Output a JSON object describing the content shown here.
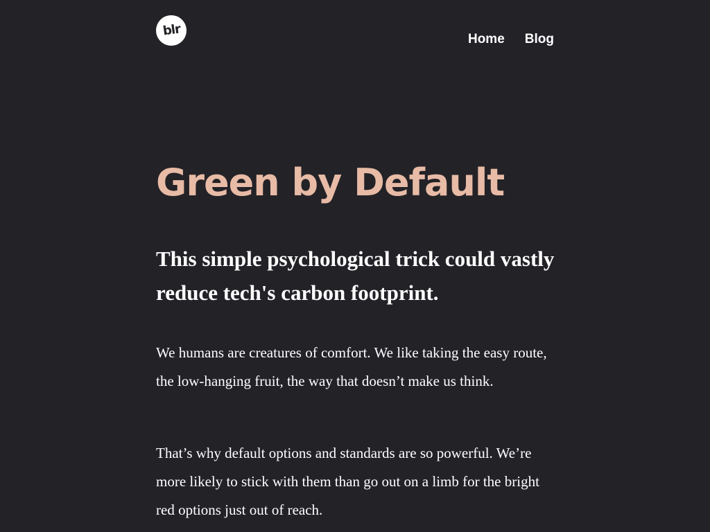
{
  "header": {
    "logo_text": "blr",
    "nav": {
      "home_label": "Home",
      "blog_label": "Blog"
    }
  },
  "article": {
    "title": "Green by Default",
    "subtitle": "This simple psychological trick could vastly reduce tech's carbon footprint.",
    "paragraphs": [
      "We humans are creatures of comfort. We like taking the easy route, the low-hanging fruit, the way that doesn’t make us think.",
      "That’s why default options and standards are so powerful. We’re more likely to stick with them than go out on a limb for the bright red options just out of reach."
    ]
  },
  "colors": {
    "background": "#232227",
    "title": "#e8bba6",
    "text": "#ffffff"
  }
}
